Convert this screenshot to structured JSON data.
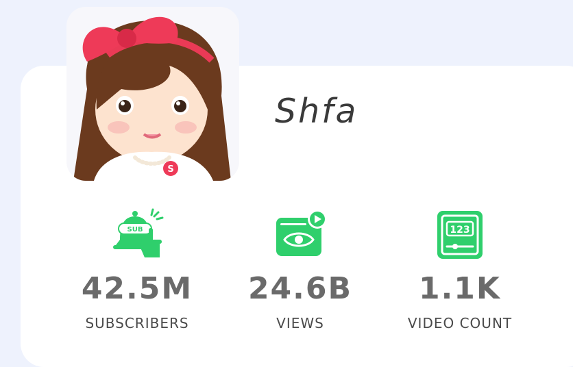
{
  "channel": {
    "name": "Shfa",
    "avatar_icon": "girl-with-red-bow-avatar",
    "avatar_badge": "S"
  },
  "stats": [
    {
      "icon": "subscribe-bell-icon",
      "value": "42.5M",
      "label": "SUBSCRIBERS"
    },
    {
      "icon": "views-eye-icon",
      "value": "24.6B",
      "label": "VIEWS"
    },
    {
      "icon": "video-count-icon",
      "value": "1.1K",
      "label": "VIDEO COUNT"
    }
  ],
  "colors": {
    "accent_green": "#2fcf6c",
    "page_background": "#eef2fd",
    "card_background": "#ffffff",
    "value_text": "#6a6a6a"
  }
}
